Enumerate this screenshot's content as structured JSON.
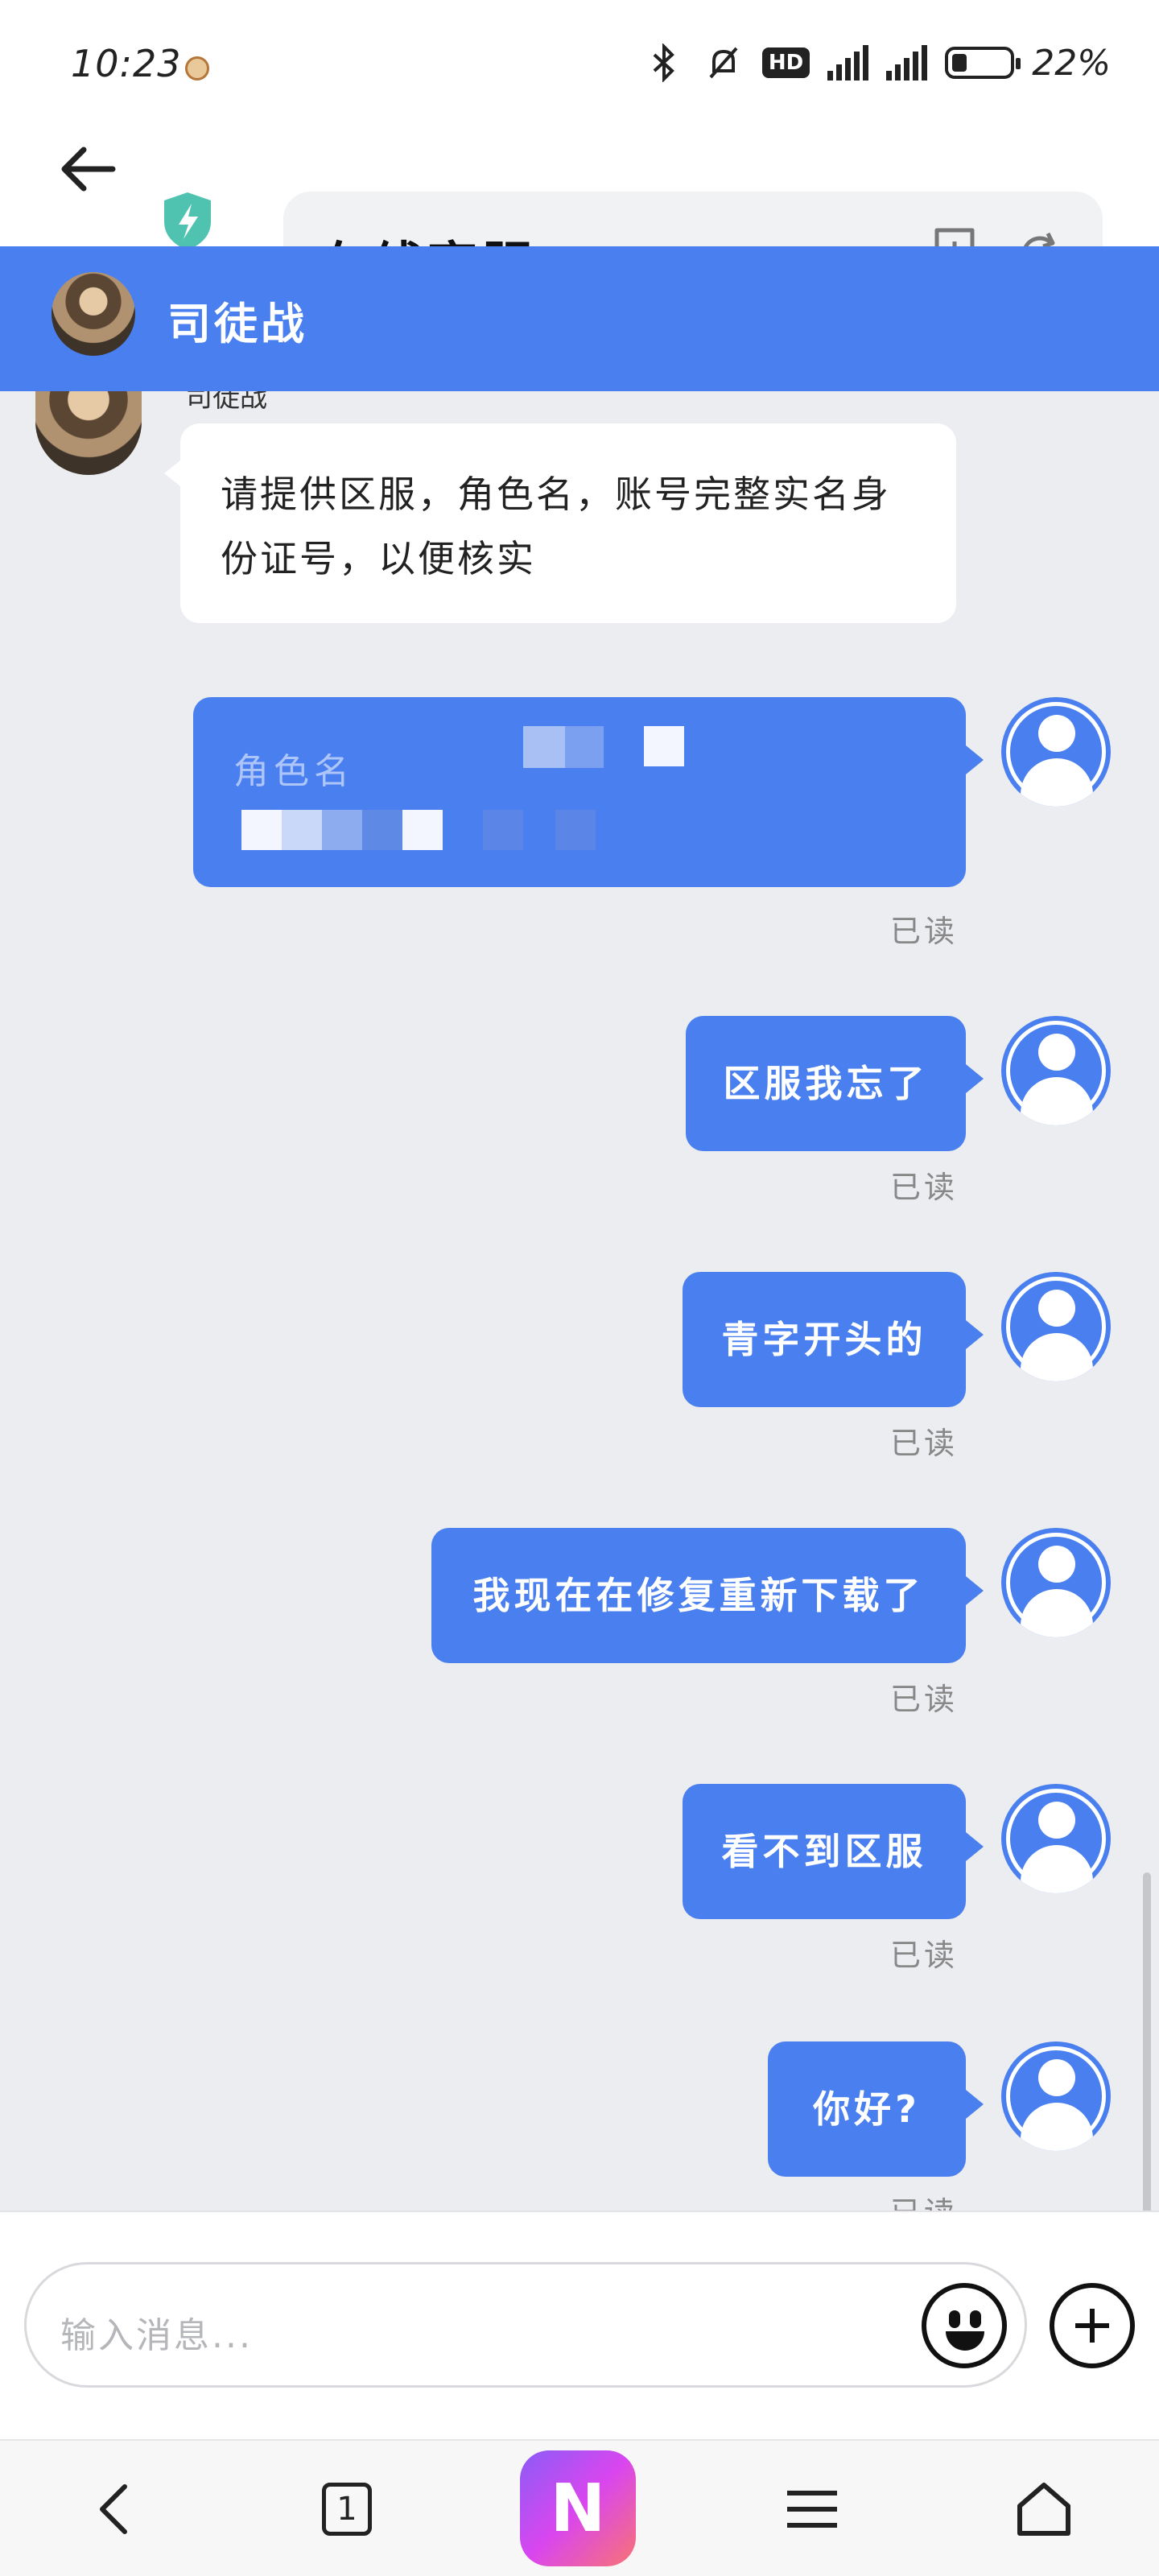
{
  "status_bar": {
    "time": "10:23",
    "network_1": "4G",
    "network_2": "4G",
    "hd_badge": "HD",
    "battery_text": "22%"
  },
  "browser": {
    "page_title": "在线客服",
    "icons": [
      "back-arrow-icon",
      "shield-lightning-icon",
      "bookmark-add-icon",
      "reload-icon"
    ]
  },
  "chat_header": {
    "agent_name": "司徒战"
  },
  "messages": {
    "agent_name_partial": "司徒战",
    "agent_message": "请提供区服，角色名，账号完整实名身份证号，以便核实",
    "redacted_partial": "角色名",
    "user_messages": [
      {
        "text": "区服我忘了",
        "status": "已读"
      },
      {
        "text": "青字开头的",
        "status": "已读"
      },
      {
        "text": "我现在在修复重新下载了",
        "status": "已读"
      },
      {
        "text": "看不到区服",
        "status": "已读"
      },
      {
        "text": "你好?",
        "status": "已读"
      }
    ],
    "redacted_status": "已读"
  },
  "input": {
    "placeholder": "输入消息..."
  },
  "navbar": {
    "tab_count": "1",
    "app_letter": "N"
  },
  "colors": {
    "accent": "#4a7ff0",
    "chat_bg": "#ecedf0"
  }
}
